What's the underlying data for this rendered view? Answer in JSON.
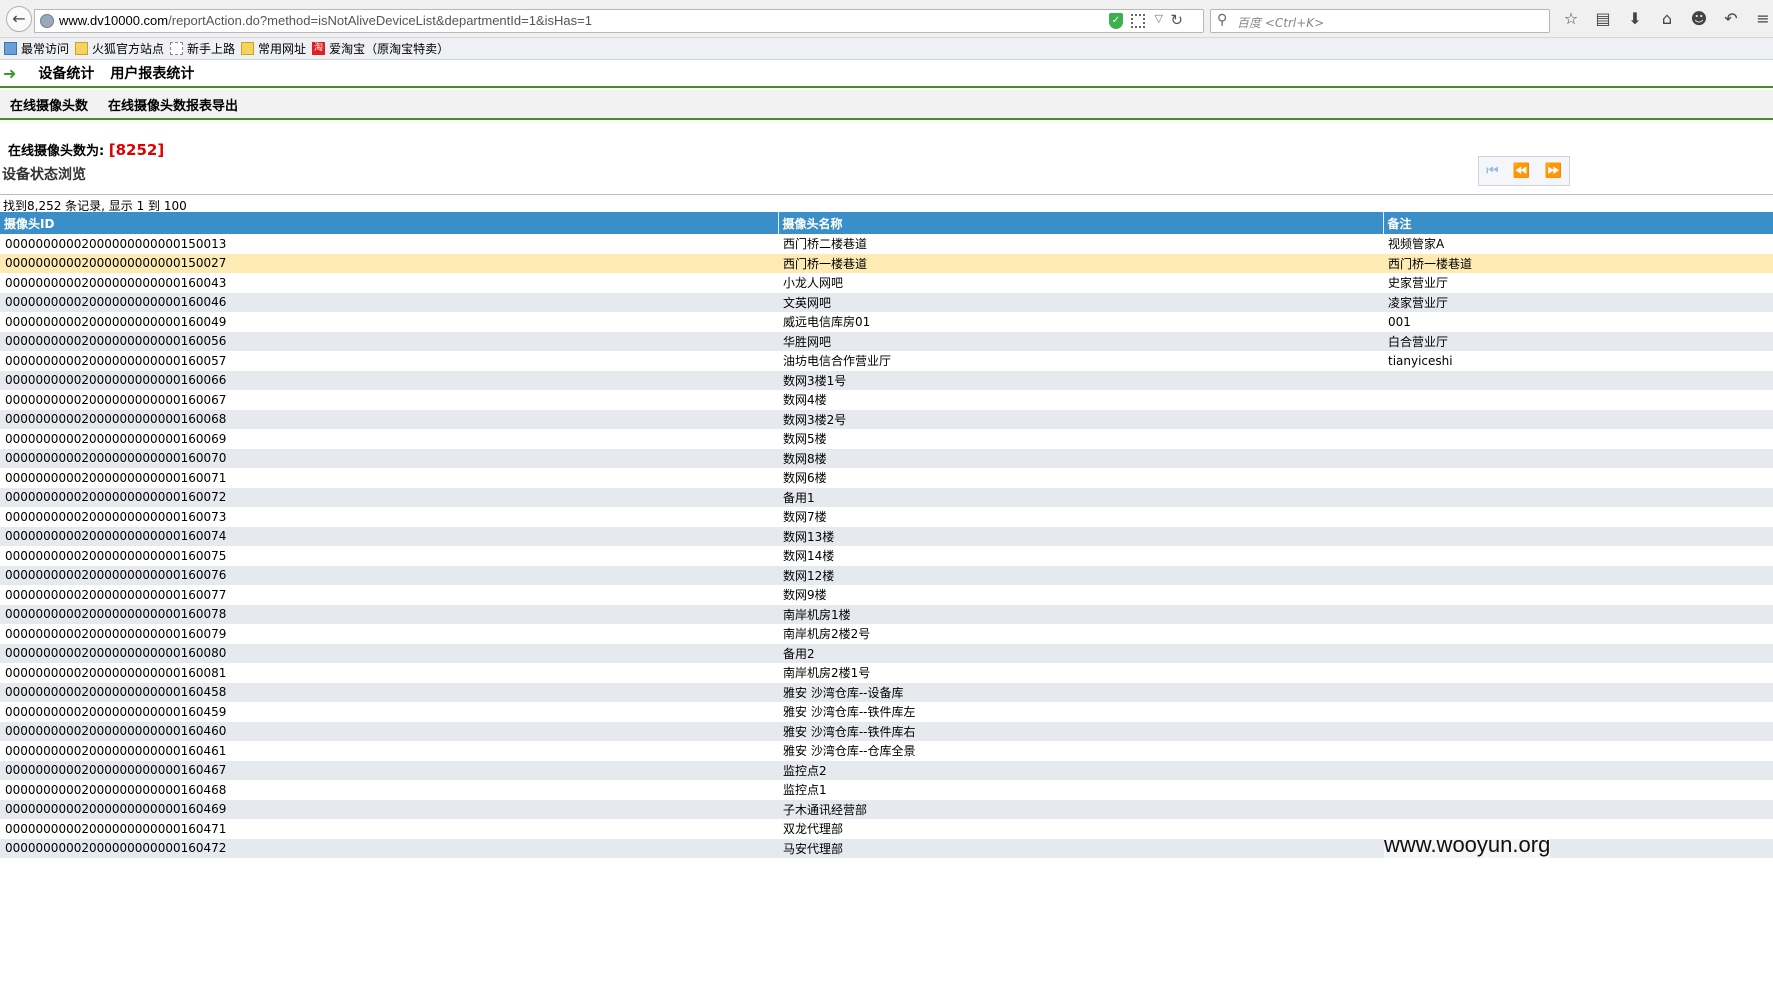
{
  "browser": {
    "url_host": "www.dv10000.com",
    "url_path": "/reportAction.do?method=isNotAliveDeviceList&departmentId=1&isHas=1",
    "search_placeholder": "百度 <Ctrl+K>"
  },
  "bookmarks": [
    {
      "label": "最常访问",
      "icon": "frequent-icon"
    },
    {
      "label": "火狐官方站点",
      "icon": "folder-icon"
    },
    {
      "label": "新手上路",
      "icon": "blank-page-icon"
    },
    {
      "label": "常用网址",
      "icon": "folder-icon"
    },
    {
      "label": "爱淘宝（原淘宝特卖）",
      "icon": "taobao-icon"
    }
  ],
  "nav1": {
    "items": [
      "设备统计",
      "用户报表统计"
    ]
  },
  "nav2": {
    "items": [
      "在线摄像头数",
      "在线摄像头数报表导出"
    ]
  },
  "summary": {
    "label": "在线摄像头数为:",
    "value": "[8252]"
  },
  "section_title": "设备状态浏览",
  "found_text": "找到8,252 条记录, 显示 1 到 100",
  "table": {
    "headers": [
      "摄像头ID",
      "摄像头名称",
      "备注"
    ],
    "selected_row": 1,
    "rows": [
      [
        "00000000002000000000000150013",
        "西门桥二楼巷道",
        "视频管家A"
      ],
      [
        "00000000002000000000000150027",
        "西门桥一楼巷道",
        "西门桥一楼巷道"
      ],
      [
        "00000000002000000000000160043",
        "小龙人网吧",
        "史家营业厅"
      ],
      [
        "00000000002000000000000160046",
        "文英网吧",
        "凌家营业厅"
      ],
      [
        "00000000002000000000000160049",
        "威远电信库房01",
        "001"
      ],
      [
        "00000000002000000000000160056",
        "华胜网吧",
        "白合营业厅"
      ],
      [
        "00000000002000000000000160057",
        "油坊电信合作营业厅",
        "tianyiceshi"
      ],
      [
        "00000000002000000000000160066",
        "数网3楼1号",
        ""
      ],
      [
        "00000000002000000000000160067",
        "数网4楼",
        ""
      ],
      [
        "00000000002000000000000160068",
        "数网3楼2号",
        ""
      ],
      [
        "00000000002000000000000160069",
        "数网5楼",
        ""
      ],
      [
        "00000000002000000000000160070",
        "数网8楼",
        ""
      ],
      [
        "00000000002000000000000160071",
        "数网6楼",
        ""
      ],
      [
        "00000000002000000000000160072",
        "备用1",
        ""
      ],
      [
        "00000000002000000000000160073",
        "数网7楼",
        ""
      ],
      [
        "00000000002000000000000160074",
        "数网13楼",
        ""
      ],
      [
        "00000000002000000000000160075",
        "数网14楼",
        ""
      ],
      [
        "00000000002000000000000160076",
        "数网12楼",
        ""
      ],
      [
        "00000000002000000000000160077",
        "数网9楼",
        ""
      ],
      [
        "00000000002000000000000160078",
        "南岸机房1楼",
        ""
      ],
      [
        "00000000002000000000000160079",
        "南岸机房2楼2号",
        ""
      ],
      [
        "00000000002000000000000160080",
        "备用2",
        ""
      ],
      [
        "00000000002000000000000160081",
        "南岸机房2楼1号",
        ""
      ],
      [
        "00000000002000000000000160458",
        "雅安 沙湾仓库--设备库",
        ""
      ],
      [
        "00000000002000000000000160459",
        "雅安 沙湾仓库--铁件库左",
        ""
      ],
      [
        "00000000002000000000000160460",
        "雅安 沙湾仓库--铁件库右",
        ""
      ],
      [
        "00000000002000000000000160461",
        "雅安 沙湾仓库--仓库全景",
        ""
      ],
      [
        "00000000002000000000000160467",
        "监控点2",
        ""
      ],
      [
        "00000000002000000000000160468",
        "监控点1",
        ""
      ],
      [
        "00000000002000000000000160469",
        "子木通讯经营部",
        ""
      ],
      [
        "00000000002000000000000160471",
        "双龙代理部",
        ""
      ],
      [
        "00000000002000000000000160472",
        "马安代理部",
        ""
      ]
    ]
  },
  "watermark": "www.wooyun.org"
}
